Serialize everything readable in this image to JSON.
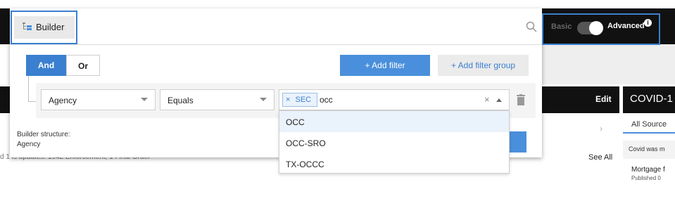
{
  "background": {
    "edit_label": "Edit",
    "covid_title": "COVID-1",
    "all_sources": "All Source",
    "covid_note": "Covid was m",
    "mortgage_title": "Mortgage f",
    "mortgage_sub": "Published 0",
    "see_all": "See All",
    "updates_text": "d 1 is updates: 1942 Enforcement, 1 Final Order",
    "chevron": "›"
  },
  "header": {
    "builder_label": "Builder",
    "builder_icon": "tree-structure-icon",
    "search_placeholder": "",
    "mode_basic": "Basic",
    "mode_advanced": "Advanced",
    "mode_advanced_on": true
  },
  "builder": {
    "logic_and": "And",
    "logic_or": "Or",
    "logic_selected": "And",
    "add_filter": "+ Add filter",
    "add_filter_group": "+ Add filter group",
    "rule": {
      "field": "Agency",
      "operator": "Equals",
      "tags": [
        {
          "remove": "×",
          "label": "SEC"
        }
      ],
      "typed_text": "occ",
      "clear": "×"
    },
    "structure_label": "Builder structure:",
    "structure_value": "Agency",
    "dropdown_options": [
      {
        "label": "OCC",
        "highlighted": true
      },
      {
        "label": "OCC-SRO",
        "highlighted": false
      },
      {
        "label": "TX-OCCC",
        "highlighted": false
      }
    ]
  },
  "colors": {
    "accent": "#3a7fd0",
    "header": "#111111"
  }
}
